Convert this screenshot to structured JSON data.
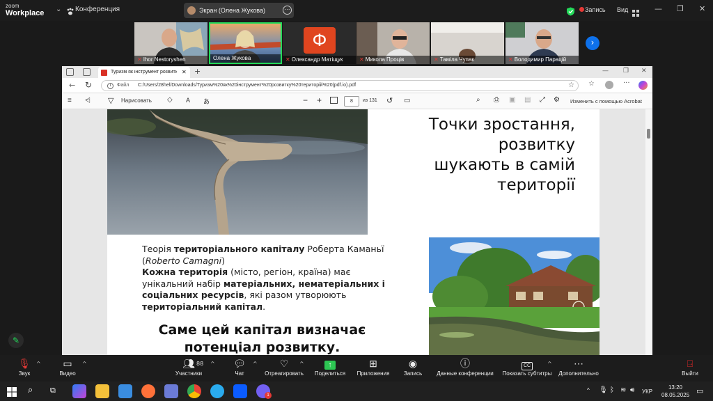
{
  "zoom": {
    "logo_line1": "zoom",
    "logo_line2": "Workplace",
    "conference_label": "Конференция",
    "screen_share_label": "Экран (Олена Жукова)",
    "record_label": "Запись",
    "view_label": "Вид"
  },
  "participants": [
    {
      "name": "Ihor Nestoryshen"
    },
    {
      "name": "Олена Жукова"
    },
    {
      "name": "Олександр Матіщук",
      "initial": "Ф"
    },
    {
      "name": "Микола Проців"
    },
    {
      "name": "Таміла Чупак"
    },
    {
      "name": "Володимир Парацій"
    }
  ],
  "browser": {
    "tab_title": "Туризм як інструмент розвитку",
    "addr_label": "Файл",
    "url": "C:/Users/28hel/Downloads/Туризм%20як%20інструмент%20розвитку%20територій%20(pdf.io).pdf",
    "draw_label": "Нарисовать",
    "page_current": "8",
    "page_total": "из 131",
    "acrobat_label": "Изменить с помощью Acrobat"
  },
  "slide": {
    "title_lines": [
      "Точки зростання,",
      "розвитку",
      "шукають в самій",
      "території"
    ],
    "p1_prefix": "Теорія ",
    "p1_bold": "територіального капіталу",
    "p1_suffix": " Роберта Каманьї",
    "p1_paren_open": "(",
    "p1_italic": "Roberto Camagni",
    "p1_paren_close": ")",
    "p2_bold": "Кожна територія",
    "p2_text": " (місто, регіон, країна) має унікальний набір ",
    "p2_bold2": "матеріальних, нематеріальних і соціальних ресурсів",
    "p2_text2": ", які разом утворюють ",
    "p2_bold3": "територіальний капітал",
    "p2_end": ".",
    "big_line1": "Саме цей капітал визначає",
    "big_line2": "потенціал розвитку."
  },
  "controls": {
    "audio": "Звук",
    "video": "Видео",
    "participants": "Участники",
    "participants_count": "88",
    "chat": "Чат",
    "react": "Отреагировать",
    "share": "Поделиться",
    "apps": "Приложения",
    "record": "Запись",
    "info": "Данные конференции",
    "captions": "Показать субтитры",
    "more": "Дополнительно",
    "leave": "Выйти"
  },
  "taskbar": {
    "lang": "УКР",
    "time": "13:20",
    "date": "08.05.2025",
    "badge": "1"
  },
  "colors": {
    "zoom_blue": "#0e71eb",
    "active_speaker": "#23d959",
    "share_green": "#2dc653",
    "leave_red": "#e02828"
  }
}
